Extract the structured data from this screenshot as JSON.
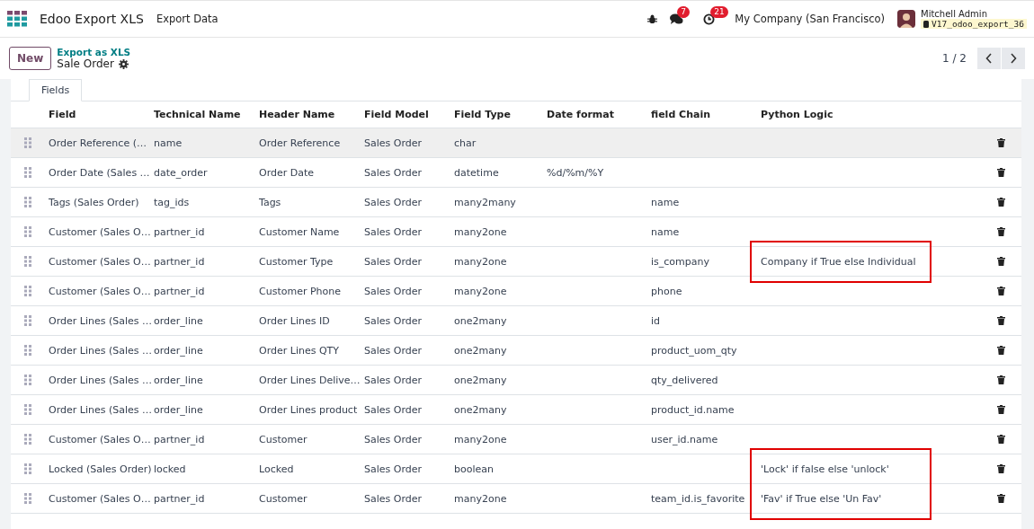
{
  "navbar": {
    "app_name": "Edoo Export XLS",
    "menu": [
      "Export Data"
    ],
    "messages_badge": "7",
    "activities_badge": "21",
    "company": "My Company (San Francisco)",
    "user": "Mitchell Admin",
    "database": "V17_odoo_export_36"
  },
  "control_panel": {
    "new_button": "New",
    "breadcrumb_link": "Export as XLS",
    "record_title": "Sale Order",
    "pager": "1 / 2"
  },
  "tabs": [
    {
      "label": "Fields",
      "selected": true
    }
  ],
  "table": {
    "columns": [
      "Field",
      "Technical Name",
      "Header Name",
      "Field Model",
      "Field Type",
      "Date format",
      "field Chain",
      "Python Logic"
    ],
    "rows": [
      {
        "cells": [
          "Order Reference (…",
          "name",
          "Order Reference",
          "Sales Order",
          "char",
          "",
          "",
          ""
        ],
        "selected": true,
        "highlighted": false
      },
      {
        "cells": [
          "Order Date (Sales …",
          "date_order",
          "Order Date",
          "Sales Order",
          "datetime",
          "%d/%m/%Y",
          "",
          ""
        ],
        "selected": false,
        "highlighted": false
      },
      {
        "cells": [
          "Tags (Sales Order)",
          "tag_ids",
          "Tags",
          "Sales Order",
          "many2many",
          "",
          "name",
          ""
        ],
        "selected": false,
        "highlighted": false
      },
      {
        "cells": [
          "Customer (Sales O…",
          "partner_id",
          "Customer Name",
          "Sales Order",
          "many2one",
          "",
          "name",
          ""
        ],
        "selected": false,
        "highlighted": false
      },
      {
        "cells": [
          "Customer (Sales O…",
          "partner_id",
          "Customer Type",
          "Sales Order",
          "many2one",
          "",
          "is_company",
          "Company if True else Individual"
        ],
        "selected": false,
        "highlighted": true
      },
      {
        "cells": [
          "Customer (Sales O…",
          "partner_id",
          "Customer Phone",
          "Sales Order",
          "many2one",
          "",
          "phone",
          ""
        ],
        "selected": false,
        "highlighted": false
      },
      {
        "cells": [
          "Order Lines (Sales …",
          "order_line",
          "Order Lines ID",
          "Sales Order",
          "one2many",
          "",
          "id",
          ""
        ],
        "selected": false,
        "highlighted": false
      },
      {
        "cells": [
          "Order Lines (Sales …",
          "order_line",
          "Order Lines QTY",
          "Sales Order",
          "one2many",
          "",
          "product_uom_qty",
          ""
        ],
        "selected": false,
        "highlighted": false
      },
      {
        "cells": [
          "Order Lines (Sales …",
          "order_line",
          "Order Lines Delive…",
          "Sales Order",
          "one2many",
          "",
          "qty_delivered",
          ""
        ],
        "selected": false,
        "highlighted": false
      },
      {
        "cells": [
          "Order Lines (Sales …",
          "order_line",
          "Order Lines product",
          "Sales Order",
          "one2many",
          "",
          "product_id.name",
          ""
        ],
        "selected": false,
        "highlighted": false
      },
      {
        "cells": [
          "Customer (Sales O…",
          "partner_id",
          "Customer",
          "Sales Order",
          "many2one",
          "",
          "user_id.name",
          ""
        ],
        "selected": false,
        "highlighted": false
      },
      {
        "cells": [
          "Locked (Sales Order)",
          "locked",
          "Locked",
          "Sales Order",
          "boolean",
          "",
          "",
          "'Lock' if false else 'unlock'"
        ],
        "selected": false,
        "highlighted": true
      },
      {
        "cells": [
          "Customer (Sales O…",
          "partner_id",
          "Customer",
          "Sales Order",
          "many2one",
          "",
          "team_id.is_favorite",
          "'Fav' if True else 'Un Fav'"
        ],
        "selected": false,
        "highlighted": true
      }
    ]
  }
}
